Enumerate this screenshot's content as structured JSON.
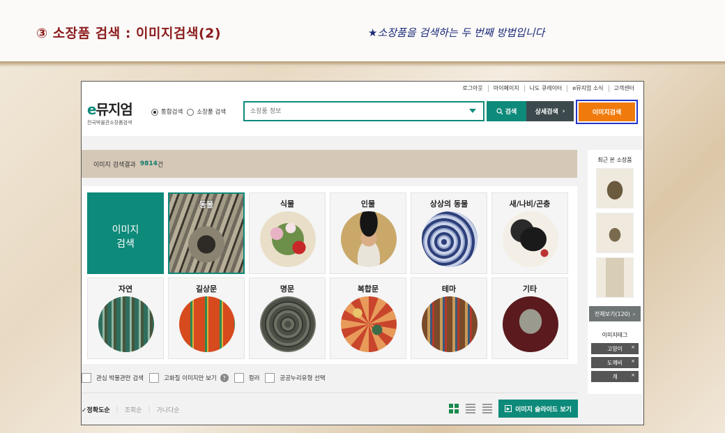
{
  "slide": {
    "title": "③ 소장품 검색 : 이미지검색(2)",
    "note": "★소장품을 검색하는 두 번째 방법입니다"
  },
  "util_links": [
    "로그아웃",
    "마이페이지",
    "나도 큐레이터",
    "e뮤지엄 소식",
    "고객센터"
  ],
  "logo": {
    "e": "e",
    "main": "뮤지엄",
    "sub": "전국박물관소장품검색"
  },
  "search": {
    "radio_all": "통합검색",
    "radio_collection": "소장품 검색",
    "placeholder": "소장품 정보",
    "search_button": "검색",
    "detail_button": "상세검색",
    "image_button": "이미지검색"
  },
  "result": {
    "label": "이미지 검색결과",
    "count": "9814",
    "unit": "건"
  },
  "tiles": {
    "big_line1": "이미지",
    "big_line2": "검색",
    "items": [
      "동물",
      "식물",
      "인물",
      "상상의 동물",
      "새/나비/곤충",
      "자연",
      "길상문",
      "명문",
      "복합문",
      "테마",
      "기타"
    ]
  },
  "filters": [
    "관심 박물관만 검색",
    "고화질 이미지만 보기",
    "컬러",
    "공공누리유형 선택"
  ],
  "help_icon_text": "?",
  "sort": {
    "active": "✓정확도순",
    "views": "조회순",
    "alpha": "가나다순"
  },
  "slideshow_button": "이미지 슬라이드 보기",
  "sidebar": {
    "recent_title": "최근 본 소장품",
    "view_all": "전체보기(120)",
    "tag_title": "이미지태그",
    "tags": [
      "고양이",
      "도깨비",
      "개"
    ]
  },
  "colors": {
    "teal": "#0e8a7a",
    "orange": "#f07a0b",
    "highlight_border": "#2233cc",
    "title_red": "#8b1c1c"
  }
}
